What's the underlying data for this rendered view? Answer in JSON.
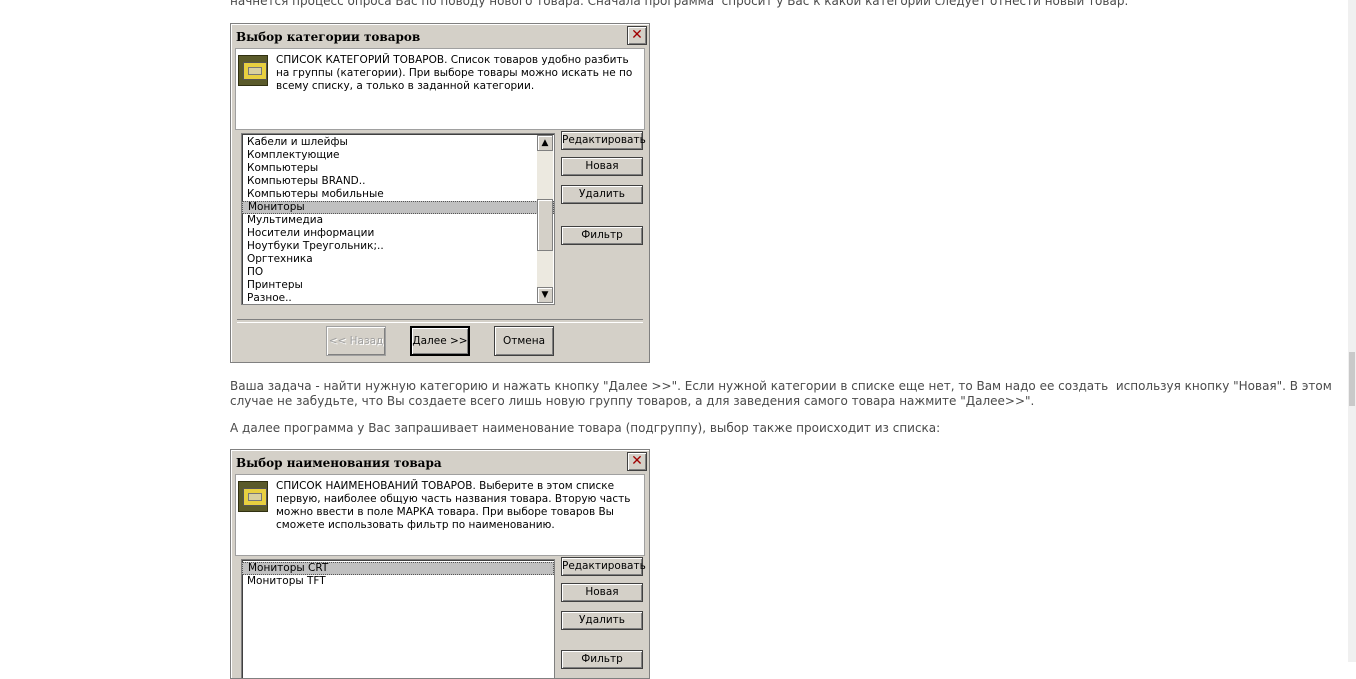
{
  "text": {
    "intro": "начнется процесс опроса Вас по поводу нового товара. Сначала программа  спросит у Вас к какой категории следует отнести новый товар:",
    "task_line1": "Ваша задача - найти нужную категорию и нажать кнопку \"Далее >>\". Если нужной категории в списке еще нет, то Вам надо ее создать  используя кнопку \"Новая\". В этом",
    "task_line2": "случае не забудьте, что Вы создаете всего лишь новую группу товаров, а для заведения самого товара нажмите \"Далее>>\".",
    "next_line": "А далее программа у Вас запрашивает наименование товара (подгруппу), выбор также происходит из списка:"
  },
  "dialog1": {
    "title": "Выбор категории товаров",
    "header_text": "СПИСОК КАТЕГОРИЙ ТОВАРОВ. Список товаров удобно разбить на группы (категории). При выборе товары можно искать не по всему списку, а только в заданной категории.",
    "items": [
      "Кабели и шлейфы",
      "Комплектующие",
      "Компьютеры",
      "Компьютеры BRAND..",
      "Компьютеры мобильные",
      "Мониторы",
      "Мультимедиа",
      "Носители информации",
      "Ноутбуки Треугольник;..",
      "Оргтехника",
      "ПО",
      "Принтеры",
      "Разное.."
    ],
    "selected_item": "Мониторы",
    "buttons": {
      "edit": "Редактировать",
      "new": "Новая",
      "delete": "Удалить",
      "filter": "Фильтр"
    },
    "footer": {
      "back": "<< Назад",
      "next": "Далее >>",
      "cancel": "Отмена"
    }
  },
  "dialog2": {
    "title": "Выбор наименования товара",
    "header_text": "СПИСОК НАИМЕНОВАНИЙ ТОВАРОВ. Выберите в этом списке первую, наиболее общую часть названия товара. Вторую часть можно ввести в поле МАРКА товара. При выборе товаров Вы сможете использовать фильтр по наименованию.",
    "items": [
      "Мониторы CRT",
      "Мониторы TFT"
    ],
    "selected_item": "Мониторы CRT",
    "buttons": {
      "edit": "Редактировать",
      "new": "Новая",
      "delete": "Удалить",
      "filter": "Фильтр"
    }
  },
  "icons": {
    "close": "close-icon",
    "category": "folder-box-icon",
    "scroll_up": "arrow-up-icon",
    "scroll_down": "arrow-down-icon"
  }
}
